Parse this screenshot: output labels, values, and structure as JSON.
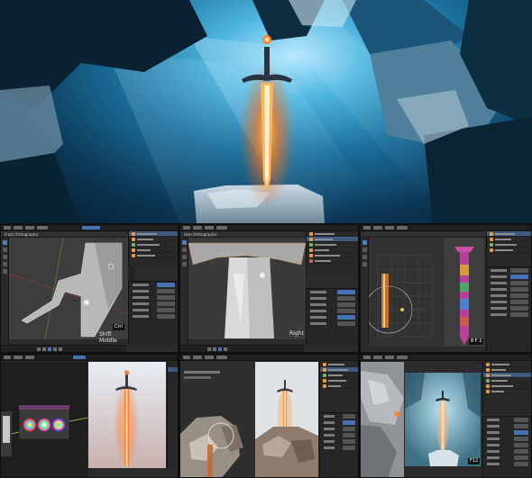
{
  "panels": {
    "viewport_1": {
      "header_text": "Front Orthographic",
      "overlay_label": "Shift Middle",
      "key_badge": "Ctrl"
    },
    "viewport_2": {
      "header_text": "User Orthographic",
      "overlay_label": "Right"
    },
    "uv_editor": {
      "corner_badge": "8 F 2"
    },
    "render_view": {
      "corner_badge": "F12"
    }
  },
  "colors": {
    "blender_bg": "#2b2b2b",
    "selection_blue": "#4772b3",
    "viewport_grey": "#3d3d3d",
    "sword_glow": "#ff8a2b",
    "sky_cyan": "#4fb6e0"
  },
  "icons": [
    "sword-render",
    "blender-cursor-icon",
    "color-wheel-icon",
    "uv-grid-icon",
    "outliner-object-icon"
  ]
}
